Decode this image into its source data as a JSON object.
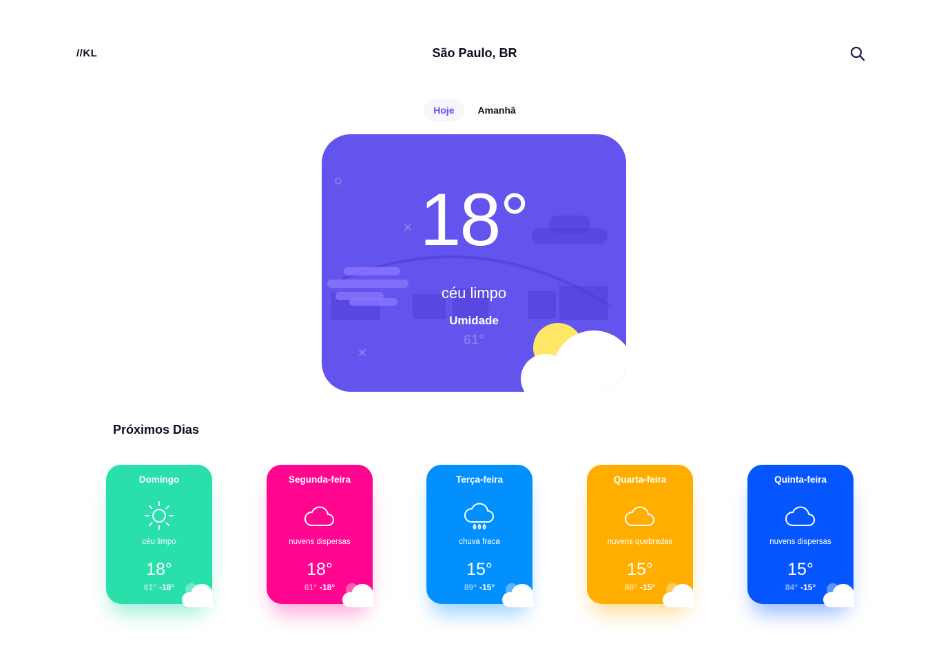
{
  "header": {
    "logo": "//KL",
    "city": "São Paulo, BR",
    "search_icon": "search-icon"
  },
  "tabs": [
    {
      "label": "Hoje",
      "active": true
    },
    {
      "label": "Amanhã",
      "active": false
    }
  ],
  "current": {
    "temp": "18°",
    "description": "céu limpo",
    "humidity_label": "Umidade",
    "humidity_value": "61°",
    "color": "#6354ee",
    "icon": "sun-behind-cloud-icon"
  },
  "forecast_title": "Próximos Dias",
  "forecast": [
    {
      "day": "Domingo",
      "icon": "sun-icon",
      "description": "céu limpo",
      "temp": "18°",
      "low": "61°",
      "high": "18°",
      "color": "#29e0aa"
    },
    {
      "day": "Segunda-feira",
      "icon": "cloud-icon",
      "description": "nuvens dispersas",
      "temp": "18°",
      "low": "61°",
      "high": "18°",
      "color": "#ff0590"
    },
    {
      "day": "Terça-feira",
      "icon": "rain-cloud-icon",
      "description": "chuva fraca",
      "temp": "15°",
      "low": "89°",
      "high": "15°",
      "color": "#0390ff"
    },
    {
      "day": "Quarta-feira",
      "icon": "cloud-icon",
      "description": "nuvens quebradas",
      "temp": "15°",
      "low": "88°",
      "high": "15°",
      "color": "#ffae00"
    },
    {
      "day": "Quinta-feira",
      "icon": "cloud-icon",
      "description": "nuvens dispersas",
      "temp": "15°",
      "low": "84°",
      "high": "15°",
      "color": "#0556ff"
    }
  ]
}
